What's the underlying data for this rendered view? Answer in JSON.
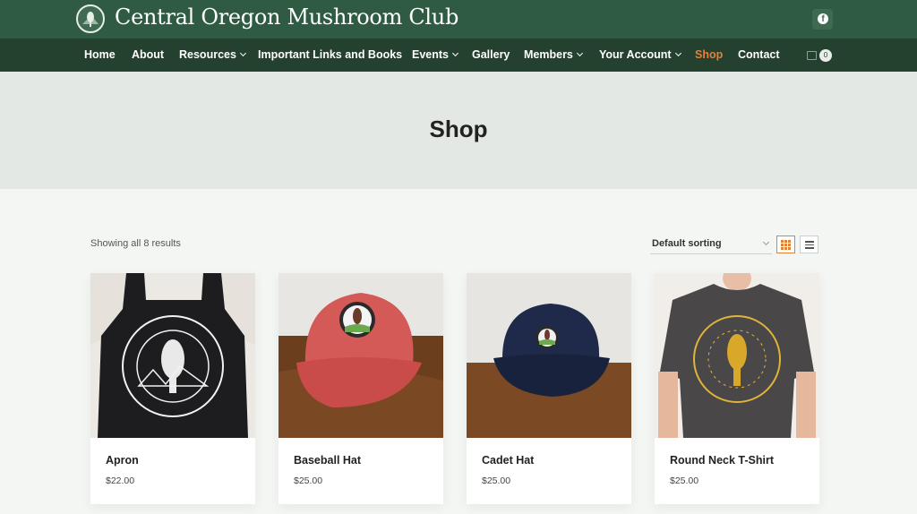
{
  "header": {
    "site_title": "Central Oregon Mushroom Club",
    "social": "facebook-icon"
  },
  "nav": {
    "items": [
      {
        "label": "Home",
        "dropdown": false
      },
      {
        "label": "About",
        "dropdown": false
      },
      {
        "label": "Resources",
        "dropdown": true
      },
      {
        "label": "Important Links and Books",
        "dropdown": false
      },
      {
        "label": "Events",
        "dropdown": true
      },
      {
        "label": "Gallery",
        "dropdown": false
      },
      {
        "label": "Members",
        "dropdown": true
      },
      {
        "label": "Your Account",
        "dropdown": true
      },
      {
        "label": "Shop",
        "dropdown": false,
        "active": true
      },
      {
        "label": "Contact",
        "dropdown": false
      }
    ],
    "cart_count": "0"
  },
  "hero": {
    "title": "Shop"
  },
  "toolbar": {
    "results_text": "Showing all 8 results",
    "sort_value": "Default sorting",
    "view_mode": "grid"
  },
  "products": [
    {
      "name": "Apron",
      "price": "$22.00"
    },
    {
      "name": "Baseball Hat",
      "price": "$25.00"
    },
    {
      "name": "Cadet Hat",
      "price": "$25.00"
    },
    {
      "name": "Round Neck T-Shirt",
      "price": "$25.00"
    }
  ],
  "colors": {
    "header_green": "#2f5b42",
    "nav_green": "#24402f",
    "accent_orange": "#e0823c",
    "hero_bg": "#e3e8e4"
  }
}
